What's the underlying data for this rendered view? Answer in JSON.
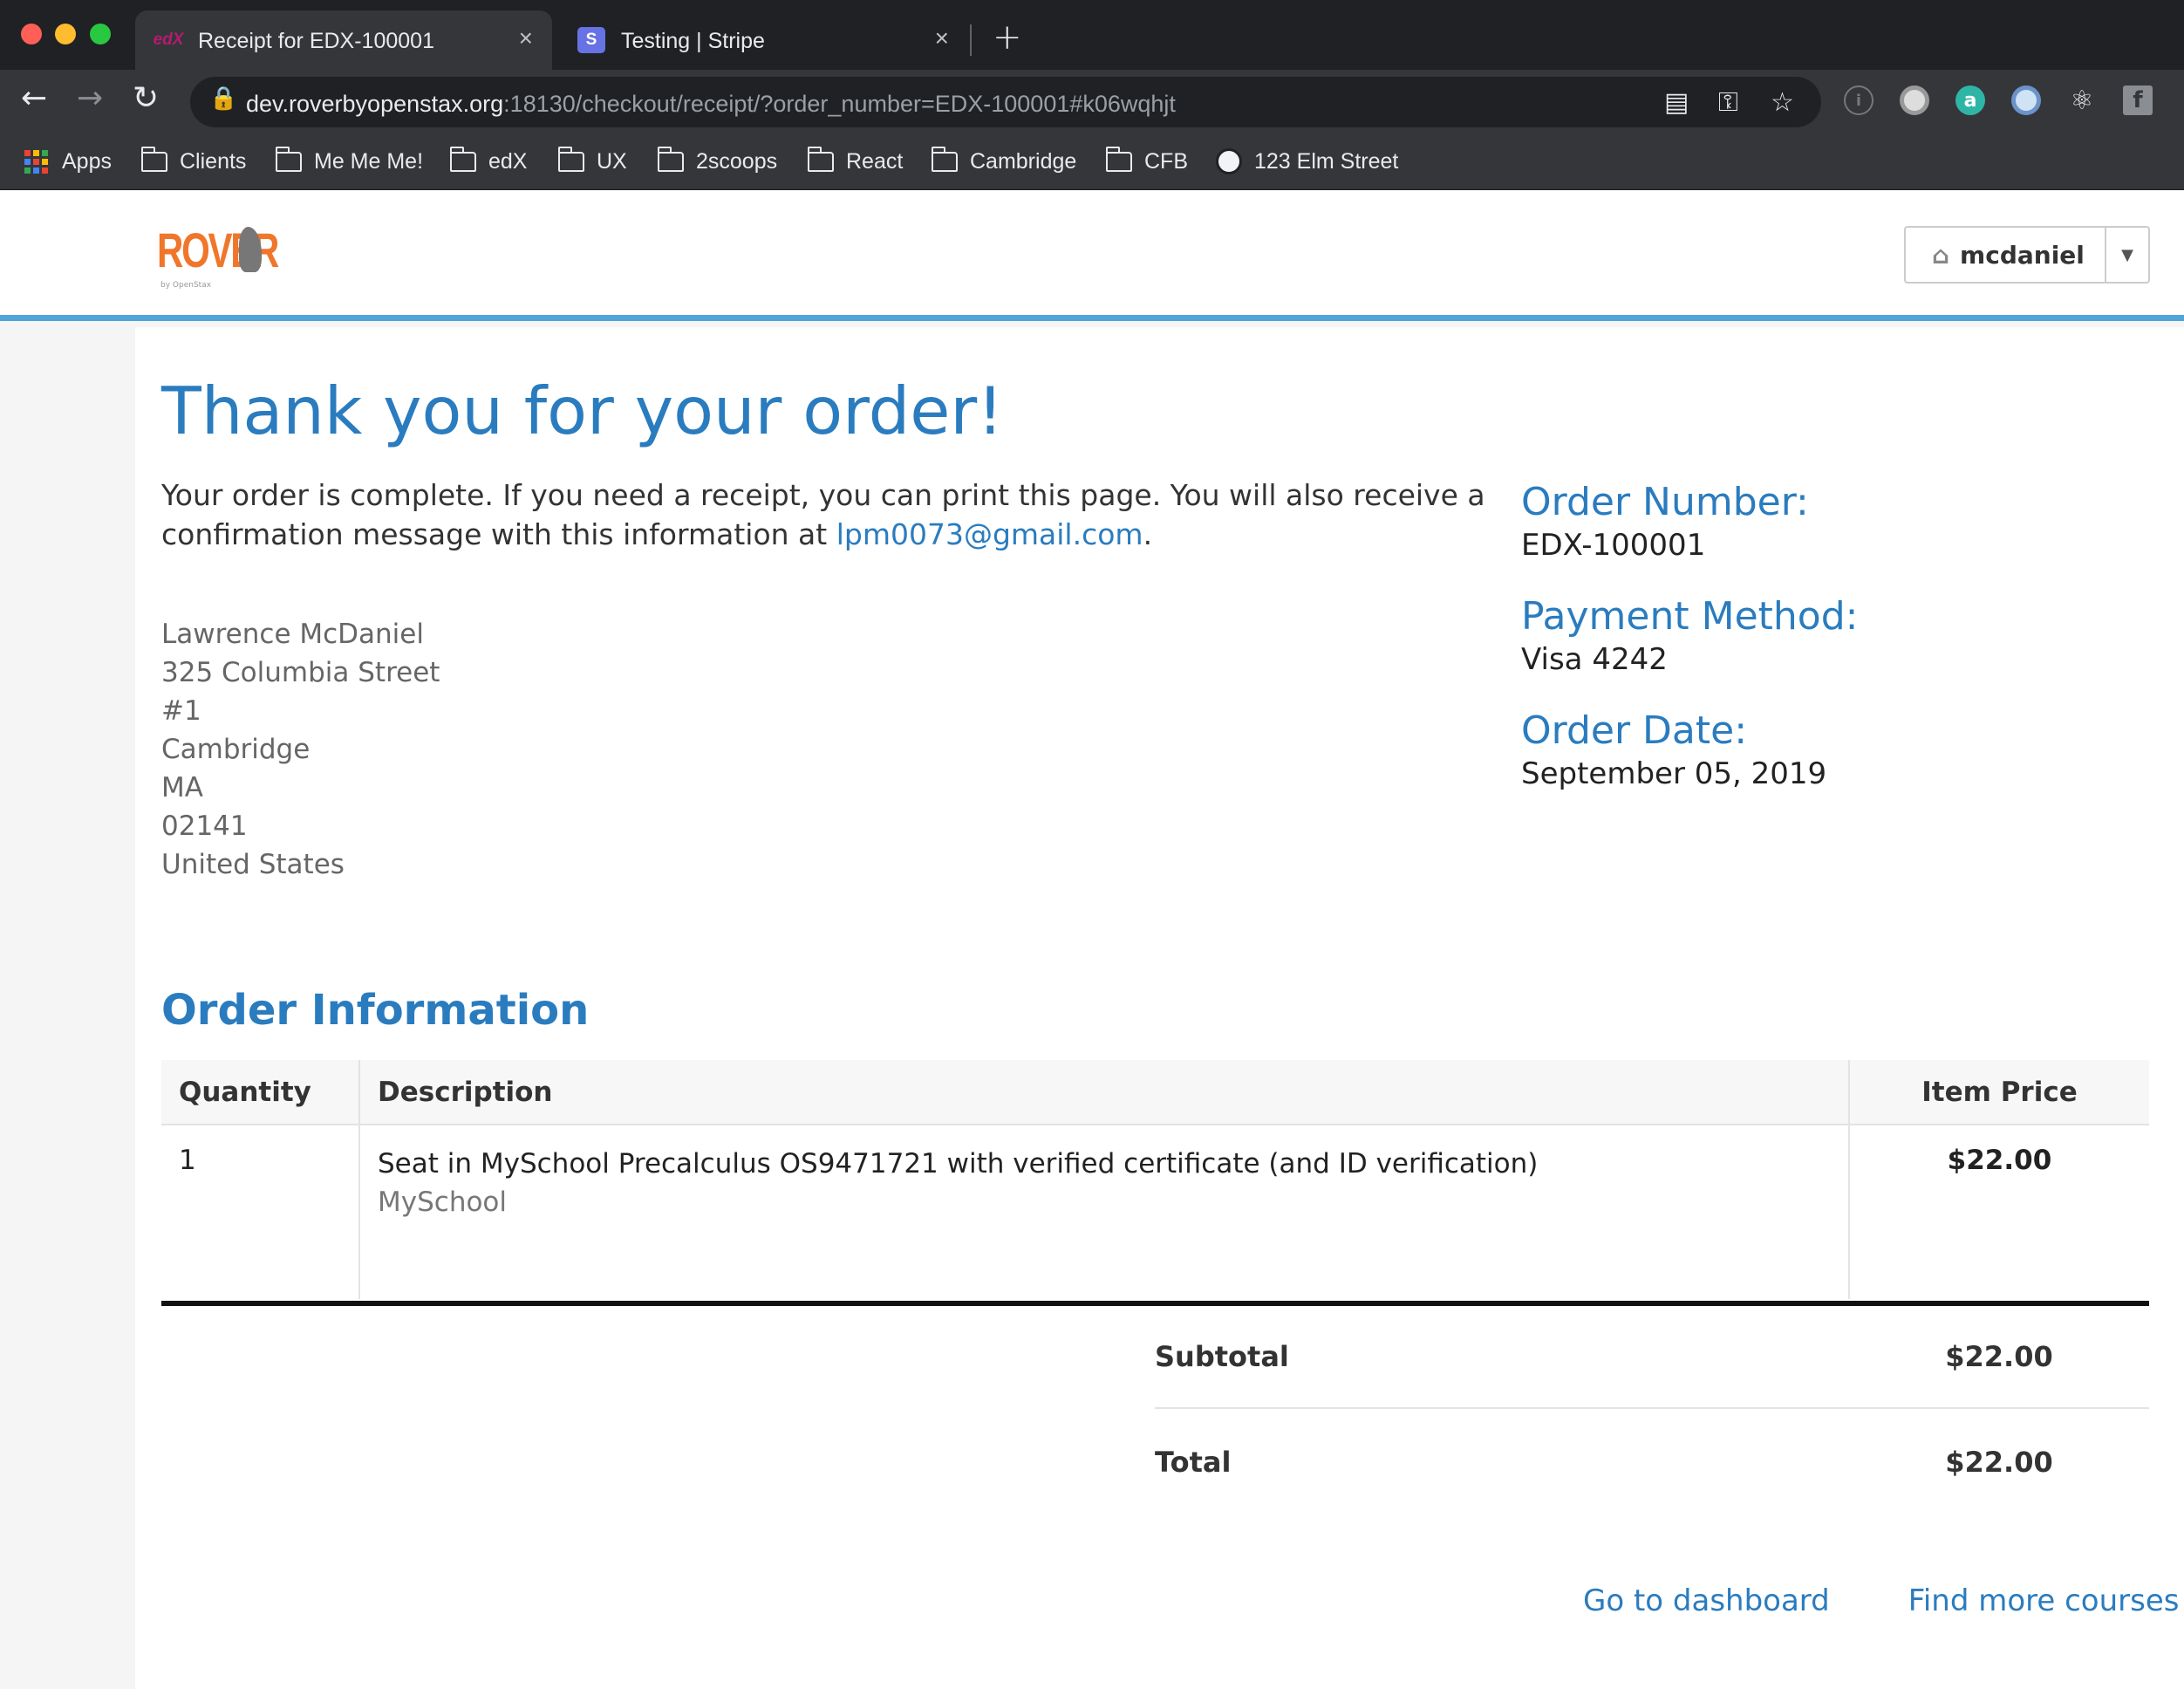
{
  "browser": {
    "tabs": [
      {
        "favicon": "edX",
        "title": "Receipt for EDX-100001",
        "close": "×"
      },
      {
        "favicon": "S",
        "title": "Testing | Stripe",
        "close": "×"
      }
    ],
    "new_tab": "+",
    "url_host": "dev.roverbyopenstax.org",
    "url_rest": ":18130/checkout/receipt/?order_number=EDX-100001#k06wqhjt",
    "icons": {
      "back": "back-arrow-icon",
      "forward": "forward-arrow-icon",
      "reload": "reload-icon",
      "lock": "lock-icon",
      "card": "card-icon",
      "key": "key-icon",
      "star": "star-icon"
    },
    "bookmarks": [
      "Apps",
      "Clients",
      "Me Me Me!",
      "edX",
      "UX",
      "2scoops",
      "React",
      "Cambridge",
      "CFB",
      "123 Elm Street"
    ]
  },
  "header": {
    "logo_text": "ROVER",
    "logo_sub": "by OpenStax",
    "username": "mcdaniel"
  },
  "receipt": {
    "title": "Thank you for your order!",
    "intro_text": "Your order is complete. If you need a receipt, you can print this page. You will also receive a confirmation message with this information at ",
    "email": "lpm0073@gmail.com",
    "intro_end": ".",
    "address": [
      "Lawrence McDaniel",
      "325 Columbia Street",
      "#1",
      "Cambridge",
      "MA",
      "02141",
      "United States"
    ],
    "order_number_label": "Order Number:",
    "order_number": "EDX-100001",
    "payment_method_label": "Payment Method:",
    "payment_method": "Visa 4242",
    "order_date_label": "Order Date:",
    "order_date": "September 05, 2019",
    "order_info_title": "Order Information",
    "table": {
      "headers": {
        "quantity": "Quantity",
        "description": "Description",
        "price": "Item Price"
      },
      "rows": [
        {
          "quantity": "1",
          "description": "Seat in MySchool Precalculus OS9471721 with verified certificate (and ID verification)",
          "org": "MySchool",
          "price": "$22.00"
        }
      ]
    },
    "subtotal_label": "Subtotal",
    "subtotal": "$22.00",
    "total_label": "Total",
    "total": "$22.00",
    "links": {
      "dashboard": "Go to dashboard",
      "courses": "Find more courses"
    }
  },
  "colors": {
    "accent": "#2a7cbf",
    "header_rule": "#4da5d9",
    "logo": "#f0762b"
  }
}
